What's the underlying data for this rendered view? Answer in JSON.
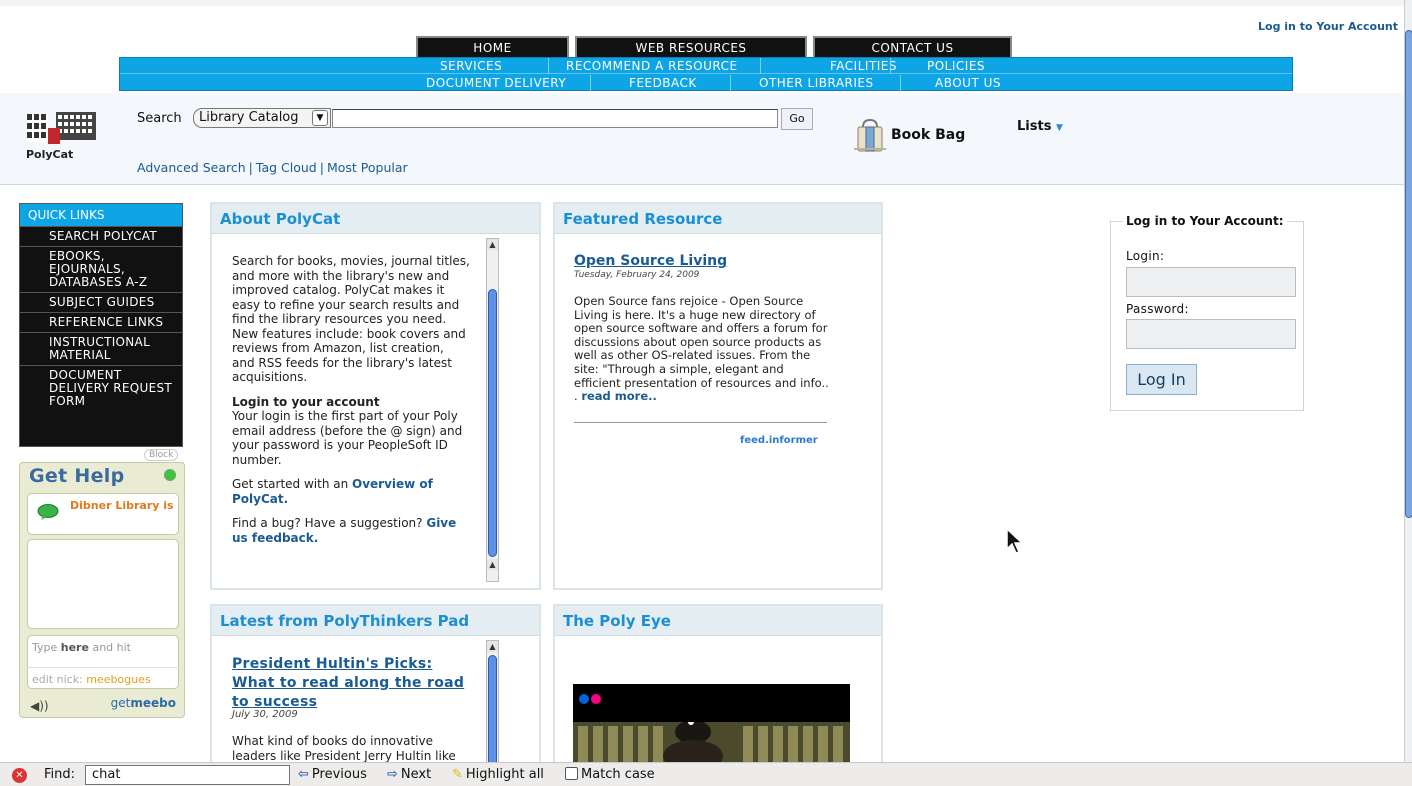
{
  "top": {
    "login_link": "Log in to Your Account"
  },
  "nav": {
    "tabs": [
      "HOME",
      "WEB RESOURCES",
      "CONTACT US"
    ],
    "row1": [
      "SERVICES",
      "RECOMMEND A RESOURCE",
      "FACILITIES",
      "POLICIES"
    ],
    "row2": [
      "DOCUMENT DELIVERY",
      "FEEDBACK",
      "OTHER LIBRARIES",
      "ABOUT US"
    ]
  },
  "catalog": {
    "logo_text": "PolyCat",
    "search_label": "Search",
    "scope_value": "Library Catalog",
    "search_value": "",
    "go_label": "Go",
    "links": [
      "Advanced Search",
      "Tag Cloud",
      "Most Popular"
    ],
    "bookbag_label": "Book Bag",
    "lists_label": "Lists"
  },
  "quick_links": {
    "header": "QUICK LINKS",
    "items": [
      "SEARCH POLYCAT",
      "EBOOKS, EJOURNALS, DATABASES A-Z",
      "SUBJECT GUIDES",
      "REFERENCE LINKS",
      "INSTRUCTIONAL MATERIAL",
      "DOCUMENT DELIVERY REQUEST FORM"
    ],
    "block_tag": "Block"
  },
  "get_help": {
    "title": "Get Help",
    "contact_name": "Dibner Library is",
    "type_hint_pre": "Type ",
    "type_hint_bold": "here",
    "type_hint_post": " and hit",
    "nick_label": "edit nick: ",
    "nick_value": "meebogues",
    "speaker": "◀))",
    "getmeebo_pre": "get",
    "getmeebo_brand": "meebo"
  },
  "about": {
    "title": "About PolyCat",
    "p1": "Search for books, movies, journal titles, and more with the library's new and improved catalog. PolyCat makes it easy to refine your search results and find the library resources you need. New features include: book covers and reviews from Amazon, list creation, and RSS feeds for the library's latest acquisitions.",
    "login_heading": "Login to your account",
    "p2": "Your login is the first part of your Poly email address (before the @ sign) and your password is your PeopleSoft ID number.",
    "p3_pre": "Get started with an ",
    "p3_link": "Overview of PolyCat.",
    "p4_pre": "Find a bug? Have a suggestion? ",
    "p4_link": "Give us feedback."
  },
  "featured": {
    "title": "Featured Resource",
    "item_title": "Open Source Living",
    "item_date": "Tuesday, February 24, 2009",
    "item_text": "Open Source fans rejoice - Open Source Living is here. It's a huge new directory of open source software and offers a forum for discussions about open source products as well as other OS-related issues. From the site: \"Through a simple, elegant and efficient presentation of resources and info.. .",
    "read_more": "read more..",
    "feed_credit": "feed.informer"
  },
  "polythinkers": {
    "title": "Latest from PolyThinkers Pad",
    "post_title": "President Hultin's Picks: What to read along the road to success",
    "post_date": "July 30, 2009",
    "post_text": "What kind of books do innovative leaders like President Jerry Hultin like"
  },
  "polyeye": {
    "title": "The Poly Eye"
  },
  "login_box": {
    "legend": "Log in to Your Account:",
    "login_label": "Login:",
    "password_label": "Password:",
    "button": "Log In"
  },
  "findbar": {
    "label": "Find:",
    "value": "chat",
    "previous": "Previous",
    "next": "Next",
    "highlight": "Highlight all",
    "match_case": "Match case"
  }
}
